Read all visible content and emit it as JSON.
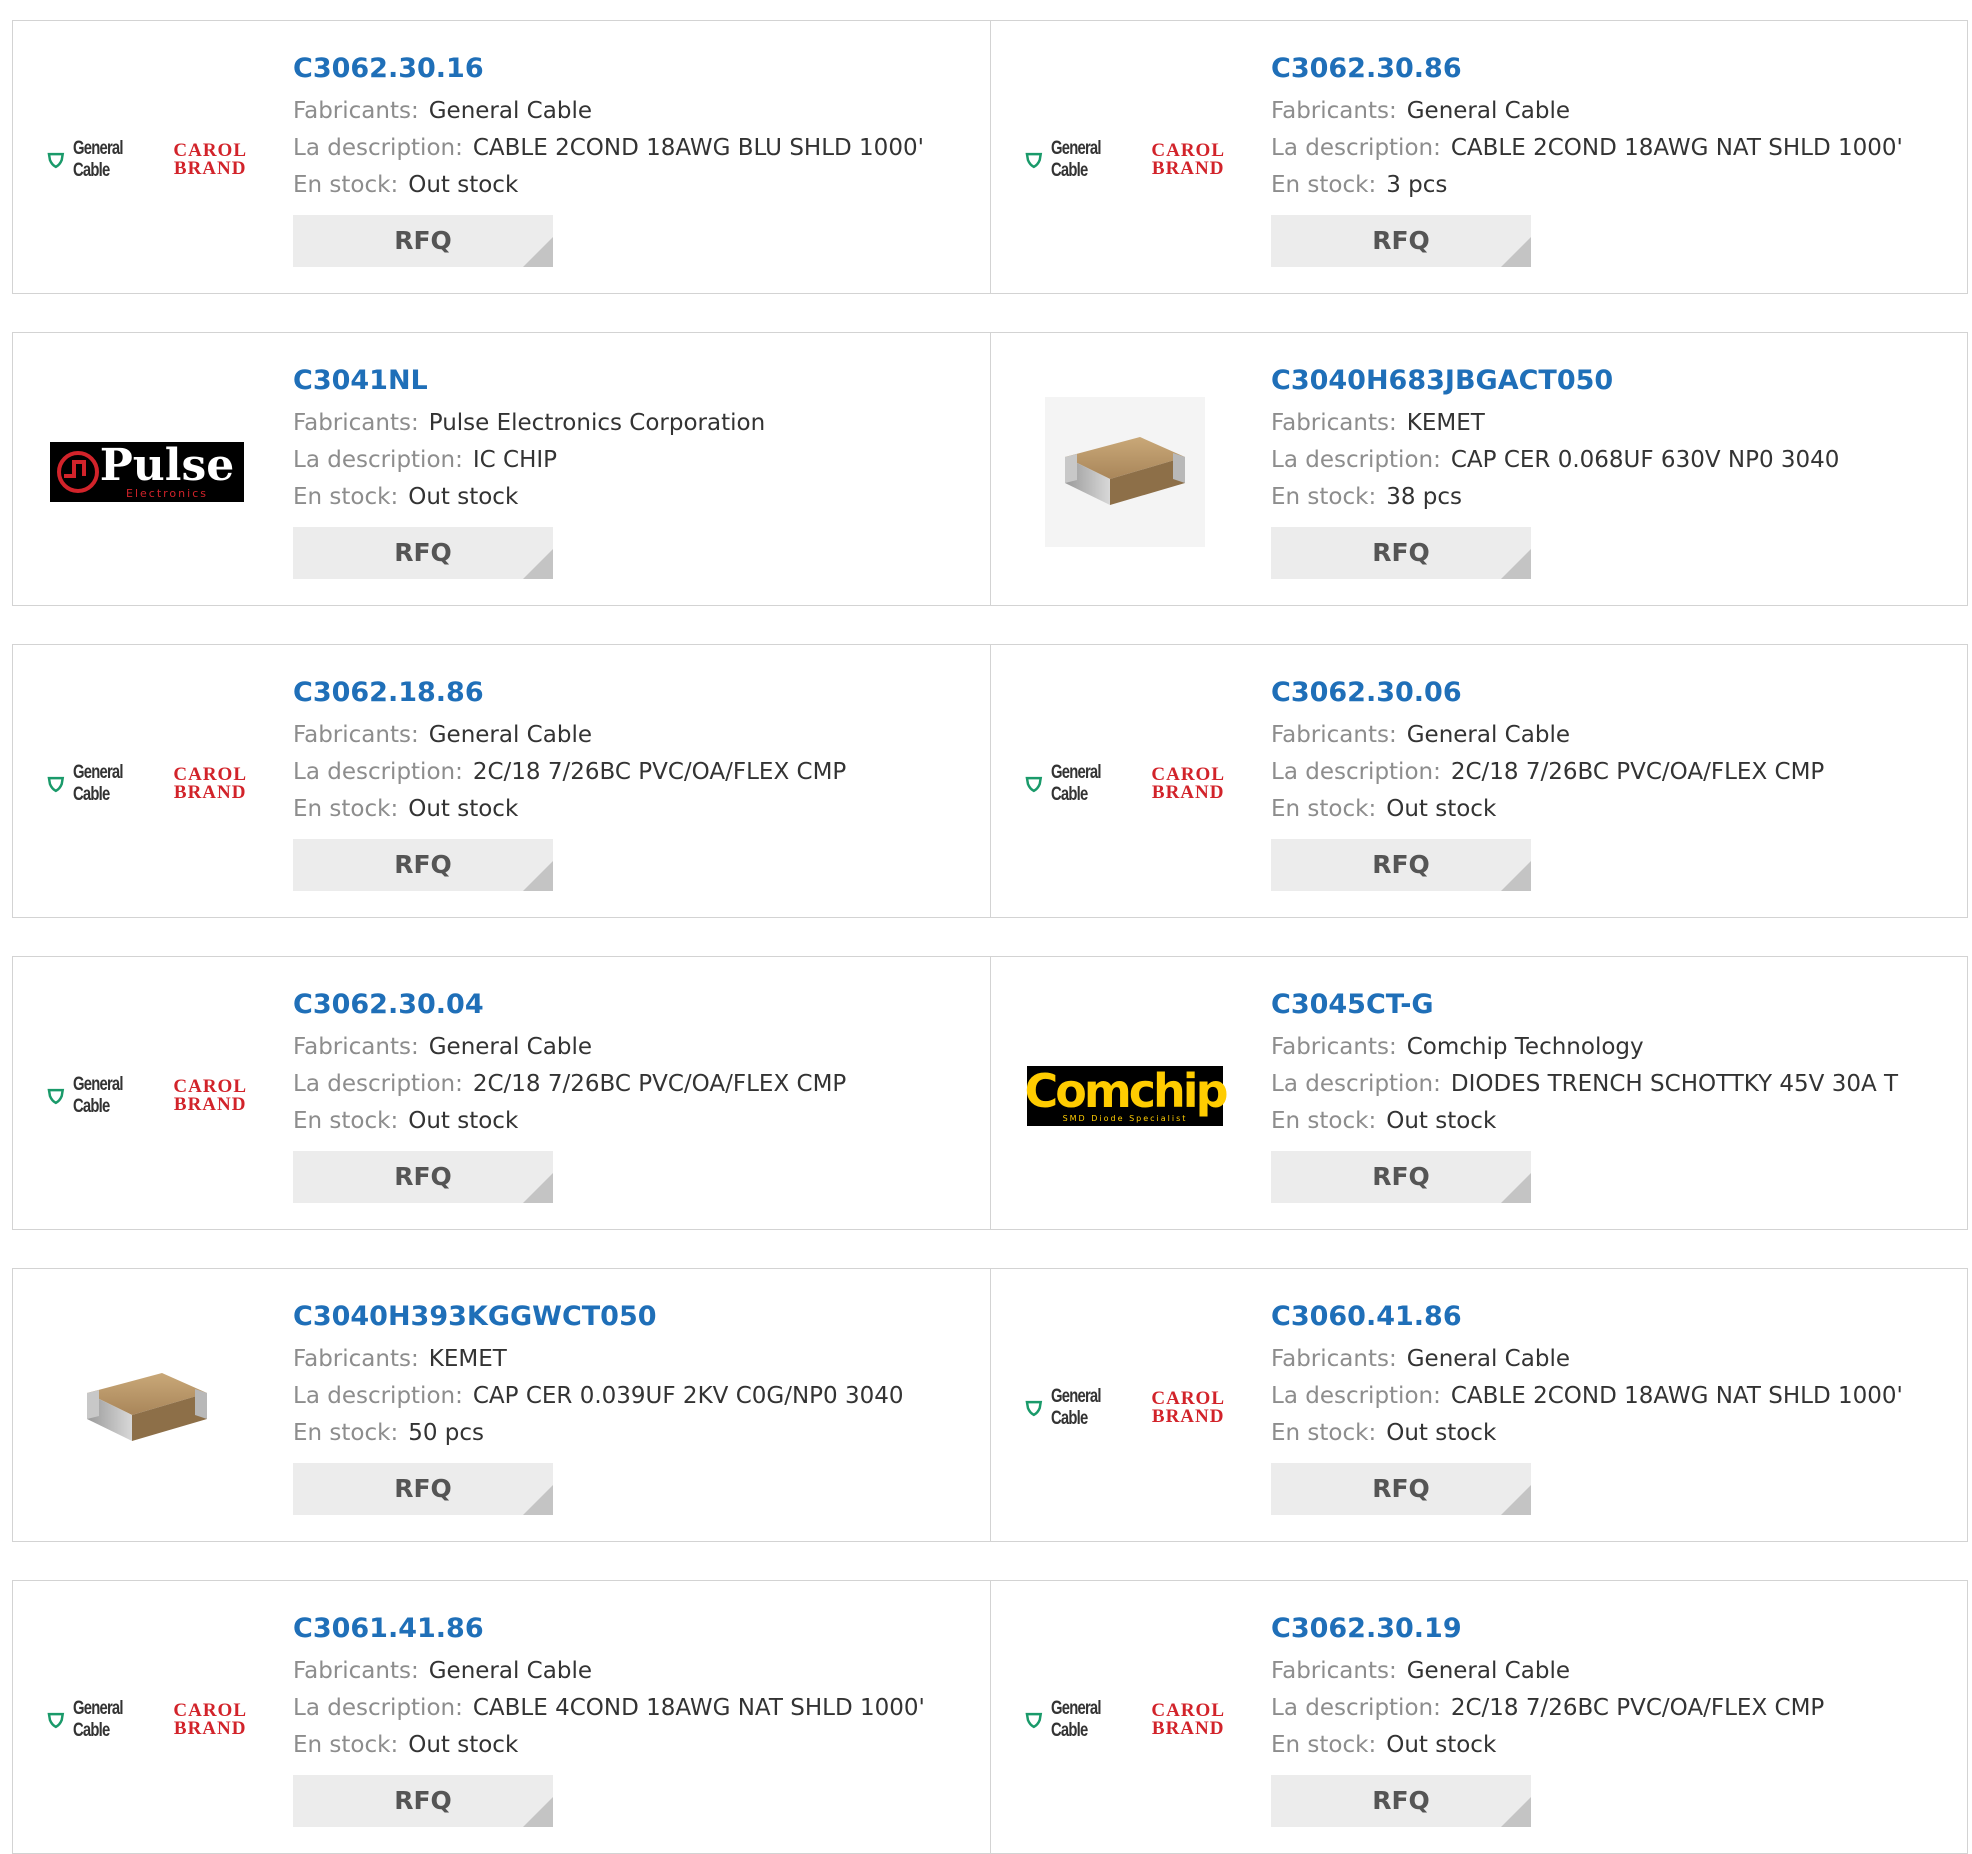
{
  "labels": {
    "manufacturer": "Fabricants:",
    "description": "La description:",
    "stock": "En stock:",
    "rfq": "RFQ"
  },
  "logo_text": {
    "general_cable": "General Cable",
    "carol_top": "CAROL",
    "carol_bottom": "BRAND",
    "pulse": "Pulse",
    "pulse_sub": "Electronics",
    "comchip": "Comchip",
    "comchip_sub": "SMD Diode Specialist"
  },
  "colors": {
    "link": "#1f6fb8",
    "label": "#8d8d8d",
    "value": "#333333",
    "rfq_bg": "#ececec",
    "border": "#d3d3d3",
    "carol_red": "#d2232a",
    "gc_green": "#1a9a6a"
  },
  "products": [
    {
      "part": "C3062.30.16",
      "manufacturer": "General Cable",
      "description": "CABLE 2COND 18AWG BLU SHLD 1000'",
      "stock": "Out stock",
      "logo": "general-cable"
    },
    {
      "part": "C3062.30.86",
      "manufacturer": "General Cable",
      "description": "CABLE 2COND 18AWG NAT SHLD 1000'",
      "stock": "3 pcs",
      "logo": "general-cable"
    },
    {
      "part": "C3041NL",
      "manufacturer": "Pulse Electronics Corporation",
      "description": "IC CHIP",
      "stock": "Out stock",
      "logo": "pulse"
    },
    {
      "part": "C3040H683JBGACT050",
      "manufacturer": "KEMET",
      "description": "CAP CER 0.068UF 630V NP0 3040",
      "stock": "38 pcs",
      "logo": "capacitor-chip"
    },
    {
      "part": "C3062.18.86",
      "manufacturer": "General Cable",
      "description": "2C/18 7/26BC PVC/OA/FLEX CMP",
      "stock": "Out stock",
      "logo": "general-cable"
    },
    {
      "part": "C3062.30.06",
      "manufacturer": "General Cable",
      "description": "2C/18 7/26BC PVC/OA/FLEX CMP",
      "stock": "Out stock",
      "logo": "general-cable"
    },
    {
      "part": "C3062.30.04",
      "manufacturer": "General Cable",
      "description": "2C/18 7/26BC PVC/OA/FLEX CMP",
      "stock": "Out stock",
      "logo": "general-cable"
    },
    {
      "part": "C3045CT-G",
      "manufacturer": "Comchip Technology",
      "description": "DIODES TRENCH SCHOTTKY 45V 30A T",
      "stock": "Out stock",
      "logo": "comchip"
    },
    {
      "part": "C3040H393KGGWCT050",
      "manufacturer": "KEMET",
      "description": "CAP CER 0.039UF 2KV C0G/NP0 3040",
      "stock": "50 pcs",
      "logo": "capacitor-chip"
    },
    {
      "part": "C3060.41.86",
      "manufacturer": "General Cable",
      "description": "CABLE 2COND 18AWG NAT SHLD 1000'",
      "stock": "Out stock",
      "logo": "general-cable"
    },
    {
      "part": "C3061.41.86",
      "manufacturer": "General Cable",
      "description": "CABLE 4COND 18AWG NAT SHLD 1000'",
      "stock": "Out stock",
      "logo": "general-cable"
    },
    {
      "part": "C3062.30.19",
      "manufacturer": "General Cable",
      "description": "2C/18 7/26BC PVC/OA/FLEX CMP",
      "stock": "Out stock",
      "logo": "general-cable"
    }
  ]
}
